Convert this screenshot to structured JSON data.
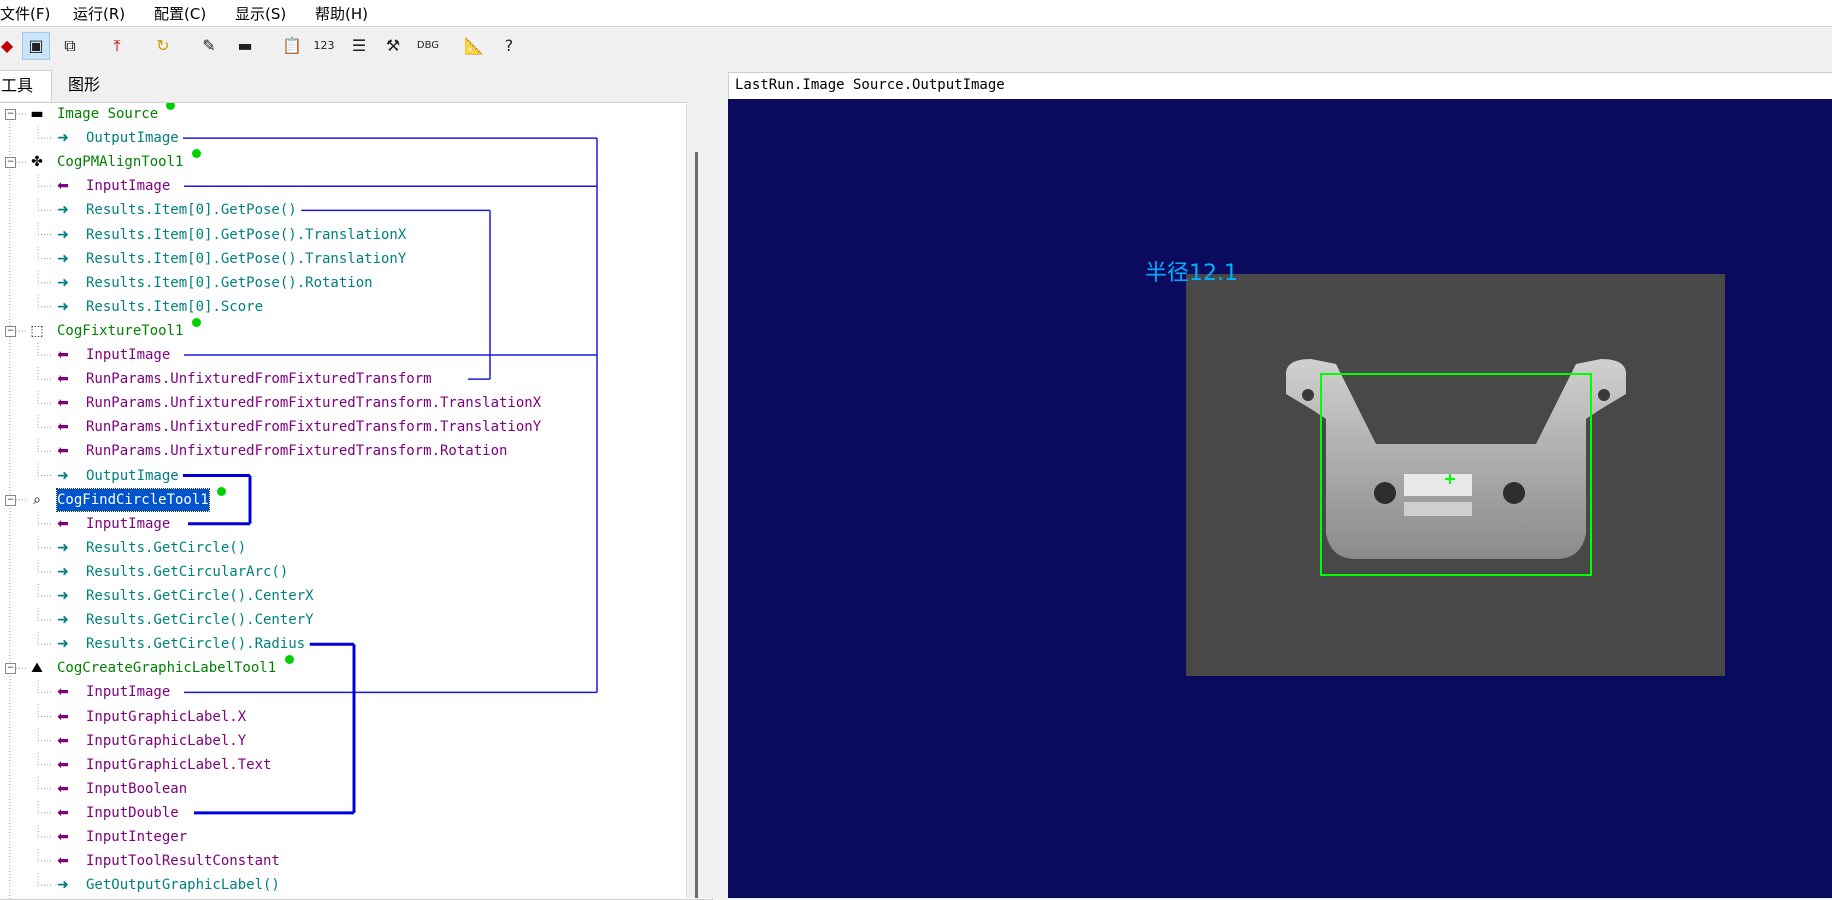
{
  "menu": [
    "文件(F)",
    "运行(R)",
    "配置(C)",
    "显示(S)",
    "帮助(H)"
  ],
  "toolbar": {
    "icons": [
      "run-icon",
      "display-icon",
      "copy-icon",
      "load-icon",
      "refresh-icon",
      "edit-icon",
      "camera-icon",
      "clipboard-icon",
      "counter-icon",
      "properties-icon",
      "tools-icon",
      "debug-icon",
      "measure-icon",
      "help-icon"
    ]
  },
  "tabs": {
    "tools": "工具",
    "graphics": "图形"
  },
  "tree": {
    "nodes": [
      {
        "text": "Image Source",
        "kind": "tool",
        "icon": "camera-icon"
      },
      {
        "text": "OutputImage",
        "kind": "out"
      },
      {
        "text": "CogPMAlignTool1",
        "kind": "tool",
        "icon": "pattern-icon"
      },
      {
        "text": "InputImage",
        "kind": "in"
      },
      {
        "text": "Results.Item[0].GetPose()",
        "kind": "out"
      },
      {
        "text": "Results.Item[0].GetPose().TranslationX",
        "kind": "out"
      },
      {
        "text": "Results.Item[0].GetPose().TranslationY",
        "kind": "out"
      },
      {
        "text": "Results.Item[0].GetPose().Rotation",
        "kind": "out"
      },
      {
        "text": "Results.Item[0].Score",
        "kind": "out"
      },
      {
        "text": "CogFixtureTool1",
        "kind": "tool",
        "icon": "fixture-icon"
      },
      {
        "text": "InputImage",
        "kind": "in"
      },
      {
        "text": "RunParams.UnfixturedFromFixturedTransform",
        "kind": "in"
      },
      {
        "text": "RunParams.UnfixturedFromFixturedTransform.TranslationX",
        "kind": "in"
      },
      {
        "text": "RunParams.UnfixturedFromFixturedTransform.TranslationY",
        "kind": "in"
      },
      {
        "text": "RunParams.UnfixturedFromFixturedTransform.Rotation",
        "kind": "in"
      },
      {
        "text": "OutputImage",
        "kind": "out"
      },
      {
        "text": "CogFindCircleTool1",
        "kind": "tool",
        "icon": "magnifier-icon",
        "selected": true
      },
      {
        "text": "InputImage",
        "kind": "in"
      },
      {
        "text": "Results.GetCircle()",
        "kind": "out"
      },
      {
        "text": "Results.GetCircularArc()",
        "kind": "out"
      },
      {
        "text": "Results.GetCircle().CenterX",
        "kind": "out"
      },
      {
        "text": "Results.GetCircle().CenterY",
        "kind": "out"
      },
      {
        "text": "Results.GetCircle().Radius",
        "kind": "out"
      },
      {
        "text": "CogCreateGraphicLabelTool1",
        "kind": "tool",
        "icon": "label-icon"
      },
      {
        "text": "InputImage",
        "kind": "in"
      },
      {
        "text": "InputGraphicLabel.X",
        "kind": "in"
      },
      {
        "text": "InputGraphicLabel.Y",
        "kind": "in"
      },
      {
        "text": "InputGraphicLabel.Text",
        "kind": "in"
      },
      {
        "text": "InputBoolean",
        "kind": "in"
      },
      {
        "text": "InputDouble",
        "kind": "in"
      },
      {
        "text": "InputInteger",
        "kind": "in"
      },
      {
        "text": "InputToolResultConstant",
        "kind": "in"
      },
      {
        "text": "GetOutputGraphicLabel()",
        "kind": "out"
      }
    ]
  },
  "display": {
    "title": "LastRun.Image Source.OutputImage",
    "overlay_label": "半径12.1"
  },
  "colors": {
    "canvas": "#0a0a5e",
    "link": "#1a1adf",
    "roi": "#00ff00",
    "overlay_text": "#00b0ff"
  }
}
